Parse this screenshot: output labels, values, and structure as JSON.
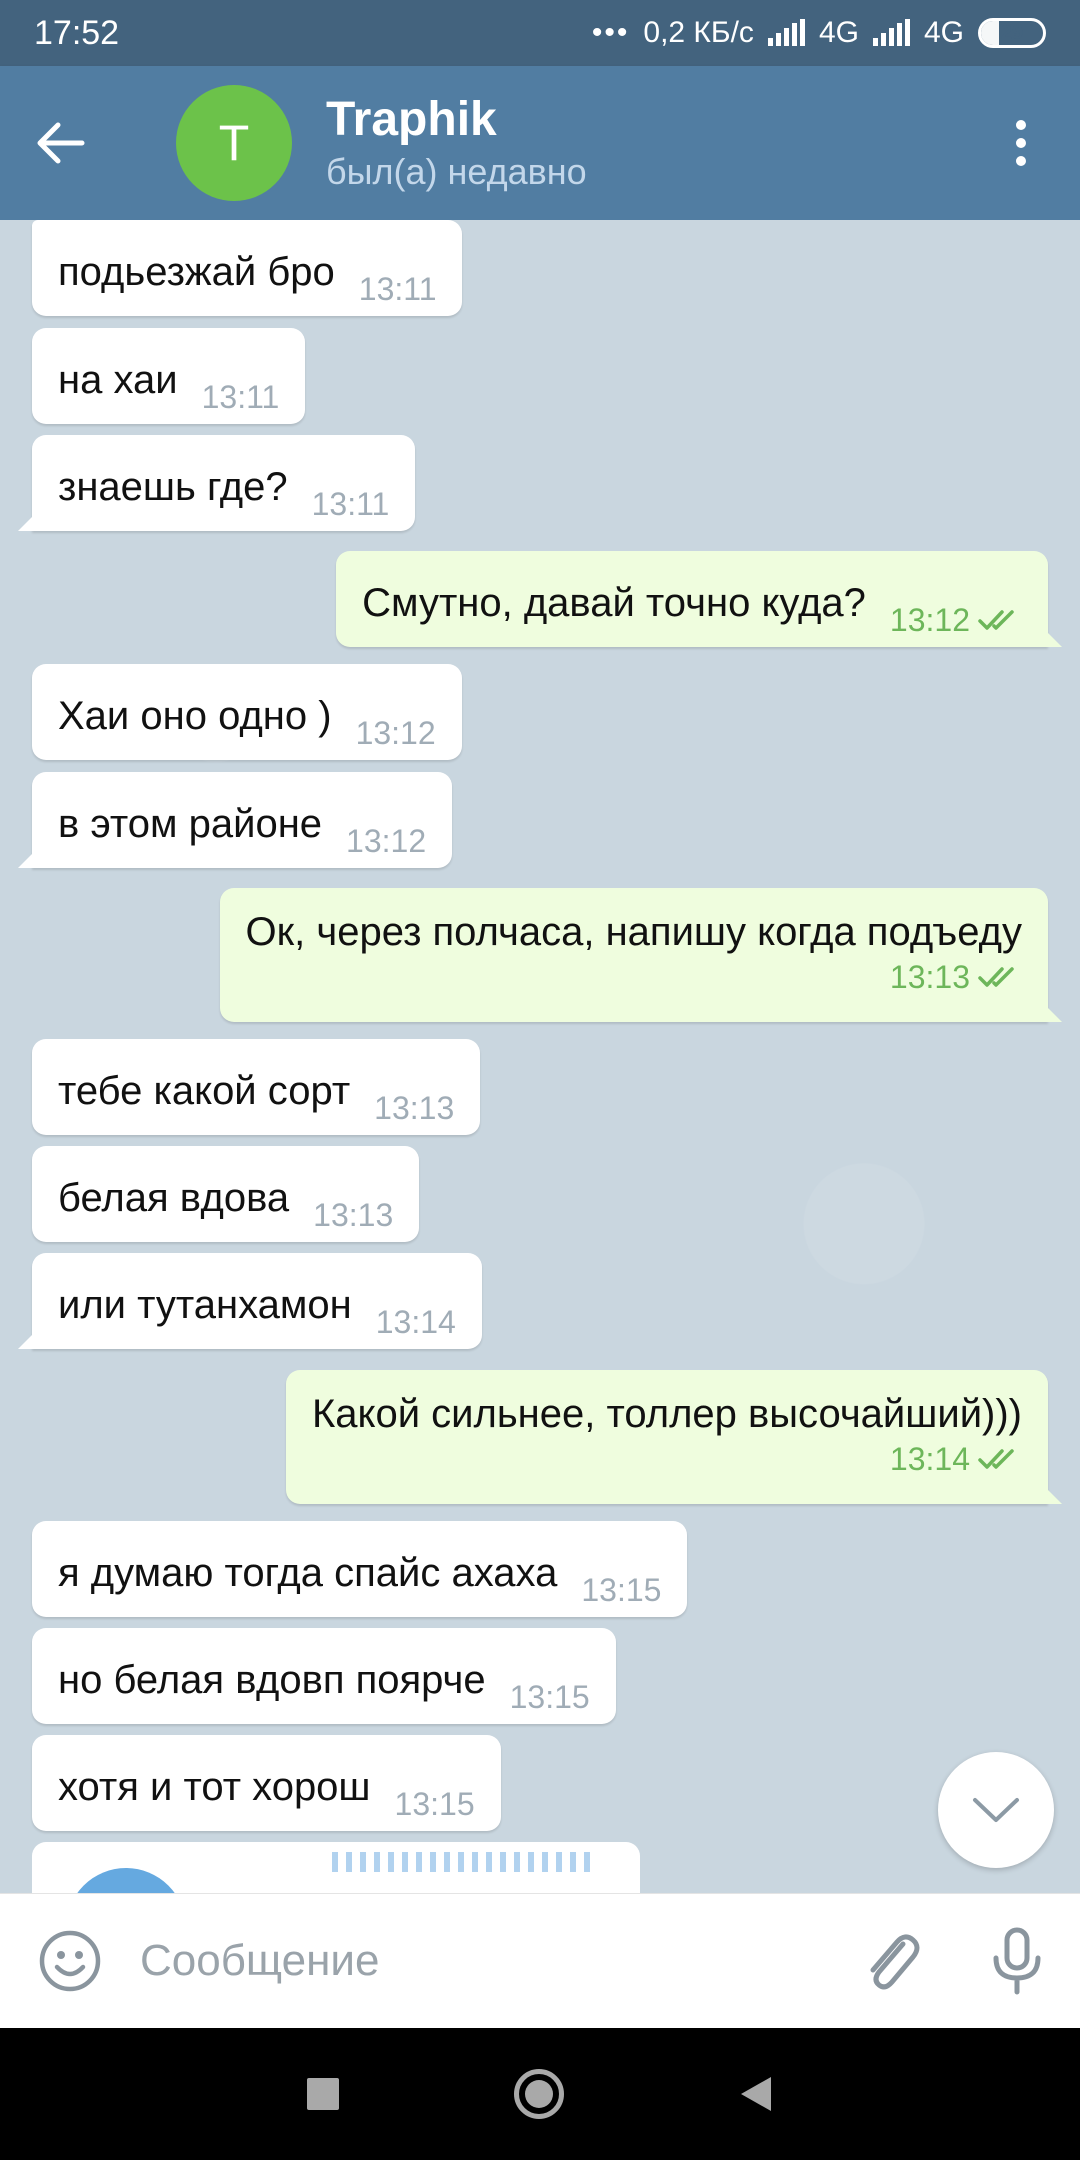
{
  "status_bar": {
    "time": "17:52",
    "network_speed": "0,2 КБ/с",
    "net1": "4G",
    "net2": "4G",
    "battery": "29",
    "battery_level": 0.29
  },
  "header": {
    "avatar_letter": "T",
    "title": "Traphik",
    "status": "был(а) недавно",
    "icons": {
      "back": "arrow-left-icon",
      "menu": "more-vertical-icon"
    }
  },
  "messages": [
    {
      "dir": "in",
      "text": "подьезжай бро",
      "time": "13:11"
    },
    {
      "dir": "in",
      "text": "на хаи",
      "time": "13:11"
    },
    {
      "dir": "in",
      "text": "знаешь где?",
      "time": "13:11"
    },
    {
      "dir": "out",
      "text": "Смутно, давай точно куда?",
      "time": "13:12"
    },
    {
      "dir": "in",
      "text": "Хаи оно одно )",
      "time": "13:12"
    },
    {
      "dir": "in",
      "text": "в этом районе",
      "time": "13:12"
    },
    {
      "dir": "out",
      "text": "Ок, через полчаса, напишу когда подъеду",
      "time": "13:13"
    },
    {
      "dir": "in",
      "text": "тебе какой сорт",
      "time": "13:13"
    },
    {
      "dir": "in",
      "text": "белая вдова",
      "time": "13:13"
    },
    {
      "dir": "in",
      "text": "или тутанхамон",
      "time": "13:14"
    },
    {
      "dir": "out",
      "text": "Какой сильнее, толлер высочайший)))",
      "time": "13:14"
    },
    {
      "dir": "in",
      "text": "я думаю тогда спайс ахаха",
      "time": "13:15"
    },
    {
      "dir": "in",
      "text": "но белая вдовп поярче",
      "time": "13:15"
    },
    {
      "dir": "in",
      "text": "хотя и тот хорош",
      "time": "13:15"
    }
  ],
  "composer": {
    "placeholder": "Сообщение",
    "icons": {
      "emoji": "emoji-icon",
      "attach": "paperclip-icon",
      "mic": "microphone-icon"
    }
  },
  "colors": {
    "header": "#517da2",
    "status_bar": "#43637e",
    "incoming_bubble": "#ffffff",
    "outgoing_bubble": "#effdde",
    "read_ticks": "#6db65a",
    "avatar": "#6cc24a"
  }
}
